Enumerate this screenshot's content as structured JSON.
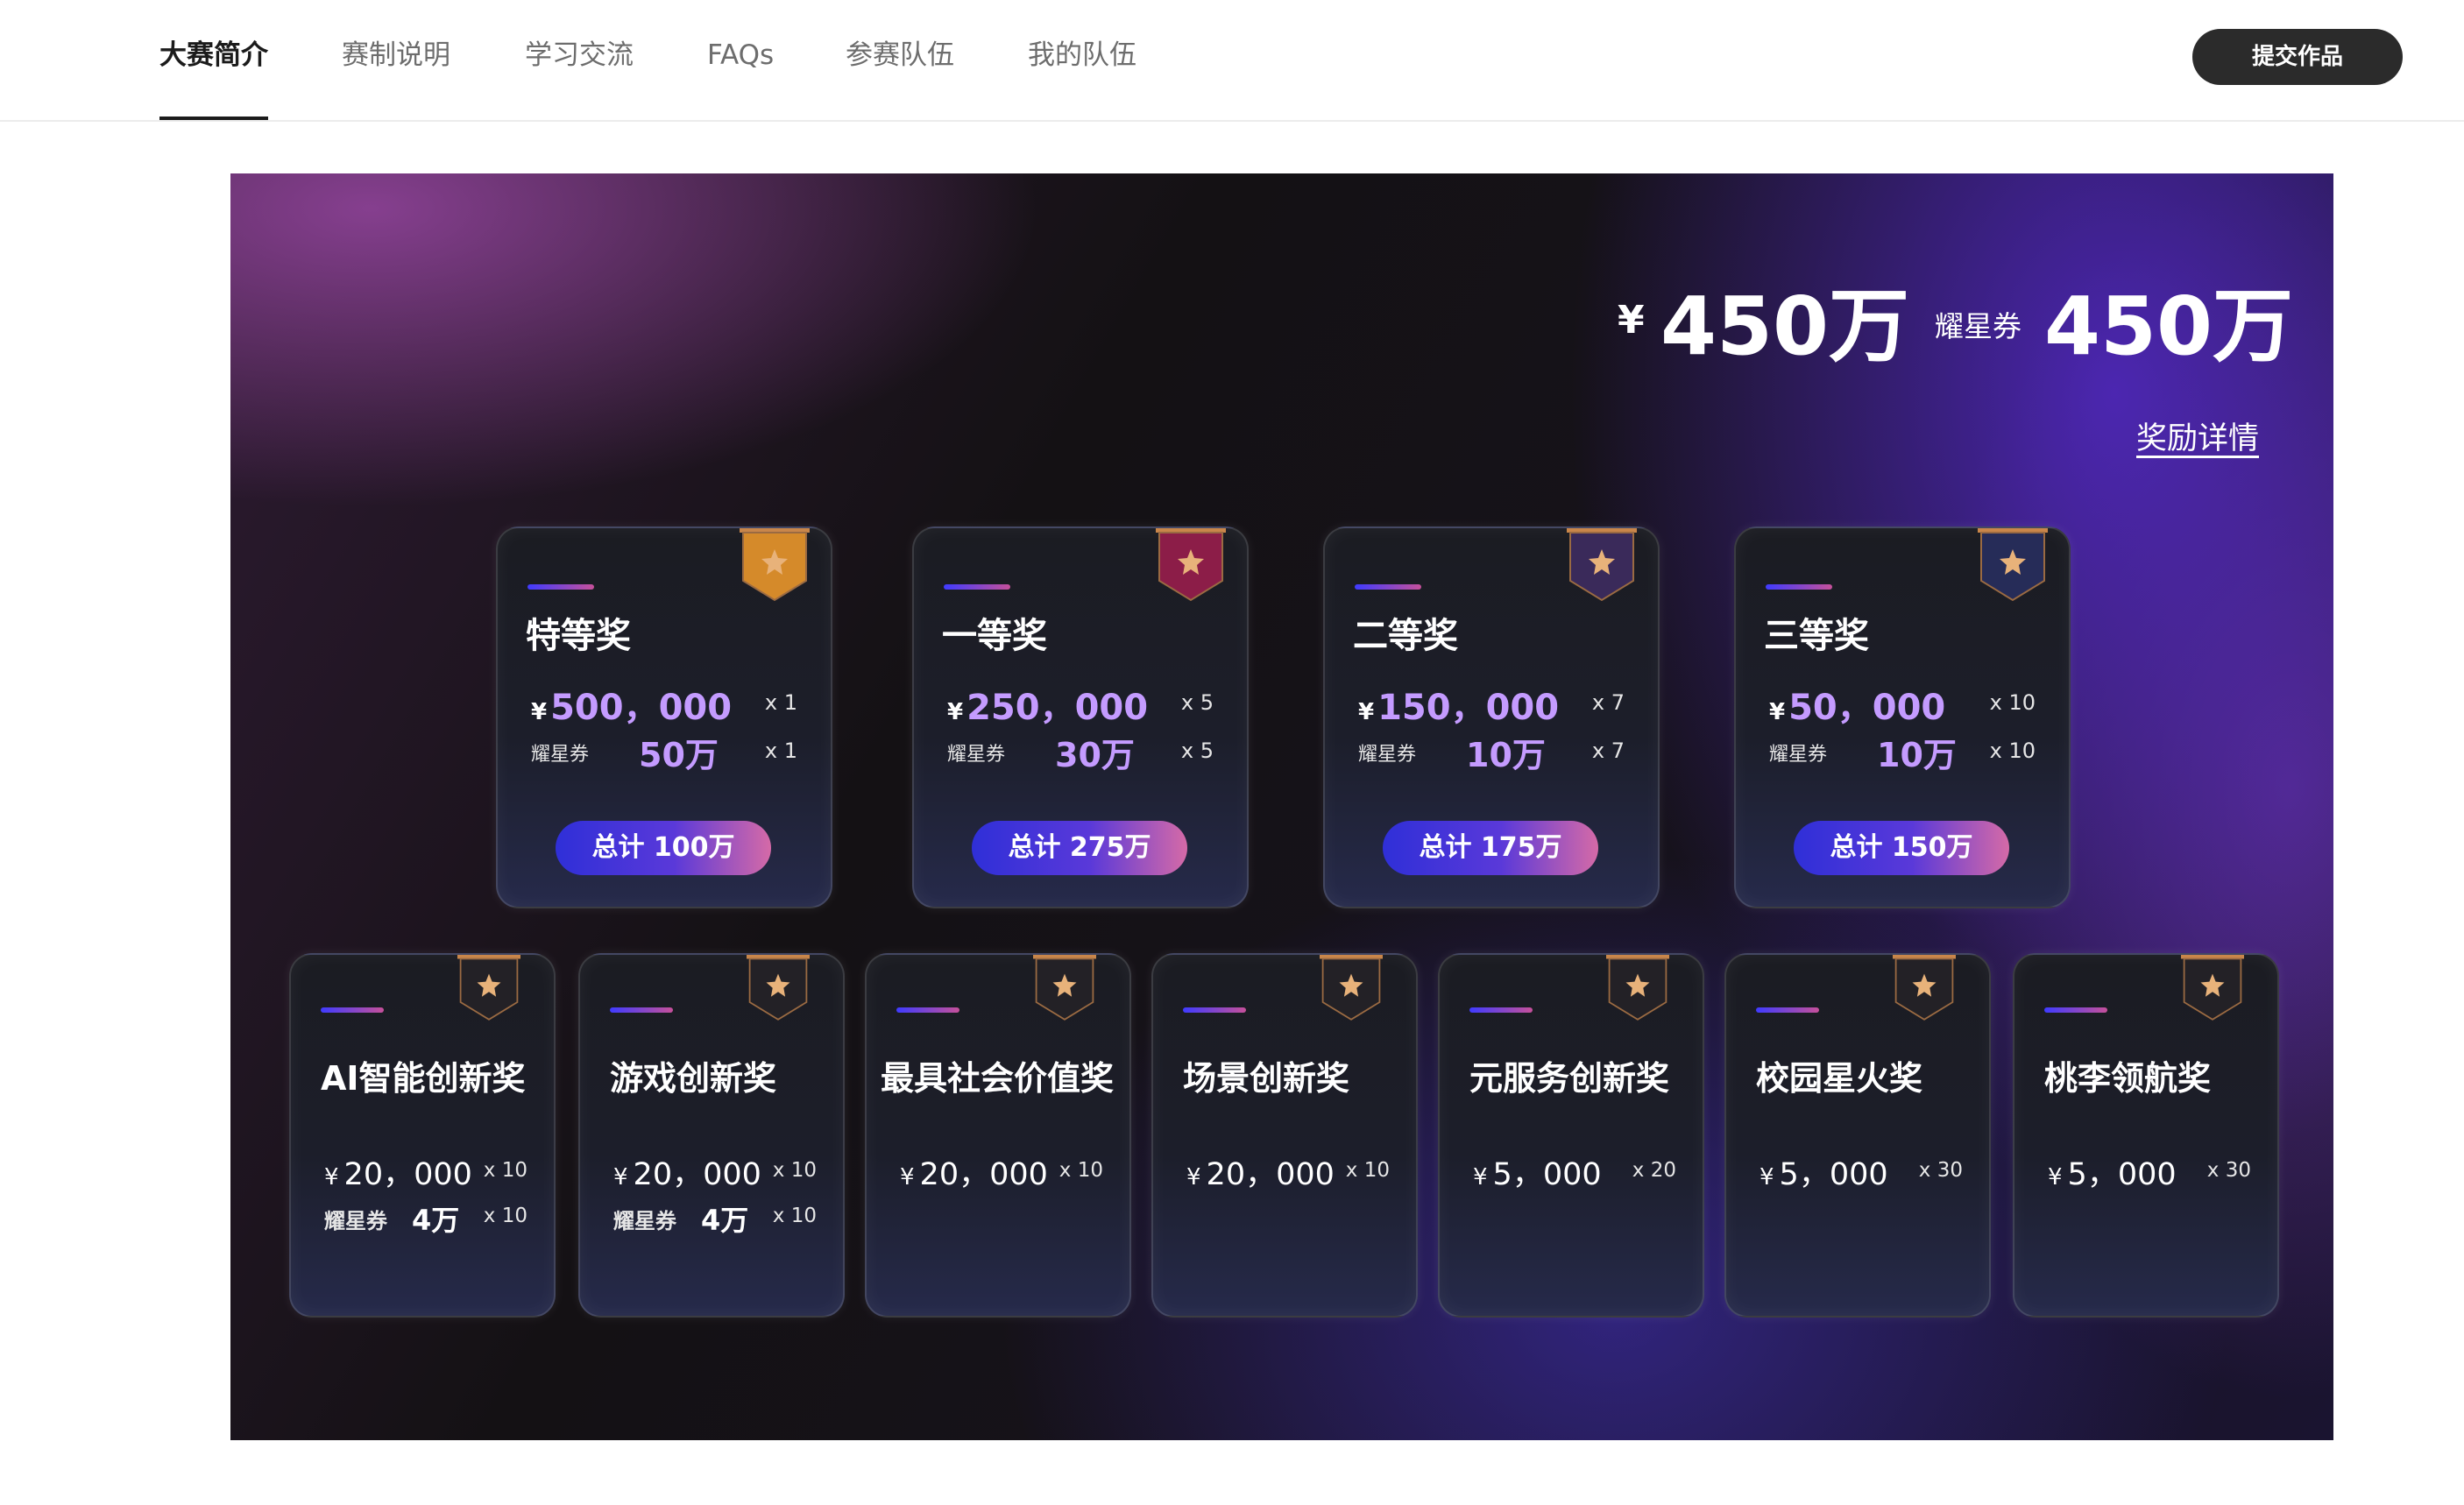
{
  "nav": {
    "tabs": [
      "大赛简介",
      "赛制说明",
      "学习交流",
      "FAQs",
      "参赛队伍",
      "我的队伍"
    ],
    "active_tab": "大赛简介",
    "submit_label": "提交作品"
  },
  "banner": {
    "total_yen_symbol": "¥",
    "total_yen_value": "450万",
    "total_coupon_label": "耀星券",
    "total_coupon_value": "450万",
    "details_link": "奖励详情",
    "coupon_label": "耀星券",
    "main_prizes": [
      {
        "title": "特等奖",
        "yen": "¥",
        "amount": "500，000",
        "amount_qty": "x 1",
        "coupon_value": "50万",
        "coupon_qty": "x 1",
        "total": "总计 100万",
        "ribbon_color": "#d58a2a"
      },
      {
        "title": "一等奖",
        "yen": "¥",
        "amount": "250，000",
        "amount_qty": "x 5",
        "coupon_value": "30万",
        "coupon_qty": "x 5",
        "total": "总计 275万",
        "ribbon_color": "#8c1d48"
      },
      {
        "title": "二等奖",
        "yen": "¥",
        "amount": "150，000",
        "amount_qty": "x 7",
        "coupon_value": "10万",
        "coupon_qty": "x 7",
        "total": "总计 175万",
        "ribbon_color": "#3a2a5a"
      },
      {
        "title": "三等奖",
        "yen": "¥",
        "amount": "50，000",
        "amount_qty": "x 10",
        "coupon_value": "10万",
        "coupon_qty": "x 10",
        "total": "总计 150万",
        "ribbon_color": "#262c58"
      }
    ],
    "special_prizes": [
      {
        "title": "AI智能创新奖",
        "yen": "¥",
        "amount": "20，000",
        "amount_qty": "x 10",
        "coupon_value": "4万",
        "coupon_qty": "x 10"
      },
      {
        "title": "游戏创新奖",
        "yen": "¥",
        "amount": "20，000",
        "amount_qty": "x 10",
        "coupon_value": "4万",
        "coupon_qty": "x 10"
      },
      {
        "title": "最具社会价值奖",
        "yen": "¥",
        "amount": "20，000",
        "amount_qty": "x 10"
      },
      {
        "title": "场景创新奖",
        "yen": "¥",
        "amount": "20，000",
        "amount_qty": "x 10"
      },
      {
        "title": "元服务创新奖",
        "yen": "¥",
        "amount": "5，000",
        "amount_qty": "x 20"
      },
      {
        "title": "校园星火奖",
        "yen": "¥",
        "amount": "5，000",
        "amount_qty": "x 30"
      },
      {
        "title": "桃李领航奖",
        "yen": "¥",
        "amount": "5，000",
        "amount_qty": "x 30"
      }
    ],
    "special_ribbon_color": "#232126"
  }
}
